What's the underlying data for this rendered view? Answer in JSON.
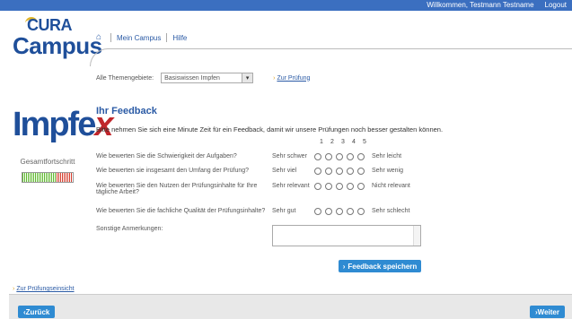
{
  "header": {
    "welcome": "Willkommen, Testmann Testname",
    "logout": "Logout"
  },
  "logo": {
    "line1": "CURA",
    "line2": "Campus"
  },
  "nav": {
    "home_icon": "house-icon",
    "mein_campus": "Mein Campus",
    "hilfe": "Hilfe"
  },
  "filter": {
    "label": "Alle Themengebiete:",
    "selected": "Basiswissen Impfen",
    "zur_pruefung": "Zur Prüfung"
  },
  "brand": {
    "name_main": "Impfe",
    "name_x": "x"
  },
  "progress": {
    "label": "Gesamtfortschritt",
    "fraction": 0.7
  },
  "feedback": {
    "title": "Ihr Feedback",
    "intro": "Bitte nehmen Sie sich eine Minute Zeit für ein Feedback, damit wir unsere Prüfungen noch besser gestalten können.",
    "scale": [
      "1",
      "2",
      "3",
      "4",
      "5"
    ],
    "questions": [
      {
        "text": "Wie bewerten Sie die Schwierigkeit der Aufgaben?",
        "left": "Sehr schwer",
        "right": "Sehr leicht"
      },
      {
        "text": "Wie bewerten sie insgesamt den Umfang der Prüfung?",
        "left": "Sehr viel",
        "right": "Sehr wenig"
      },
      {
        "text": "Wie bewerten Sie den Nutzen der Prüfungsinhalte für Ihre tägliche Arbeit?",
        "left": "Sehr relevant",
        "right": "Nicht relevant"
      },
      {
        "text": "Wie bewerten Sie die fachliche Qualität der Prüfungsinhalte?",
        "left": "Sehr gut",
        "right": "Sehr schlecht"
      }
    ],
    "comments_label": "Sonstige Anmerkungen:",
    "comments_value": "",
    "save": "Feedback speichern"
  },
  "footer": {
    "pruefungseinsicht": "Zur Prüfungseinsicht",
    "back": "Zurück",
    "next": "Weiter"
  },
  "colors": {
    "brand_blue": "#1f4f9a",
    "button_blue": "#2f8bd2",
    "accent_red": "#c0262b",
    "progress_green": "#5cb82a"
  }
}
